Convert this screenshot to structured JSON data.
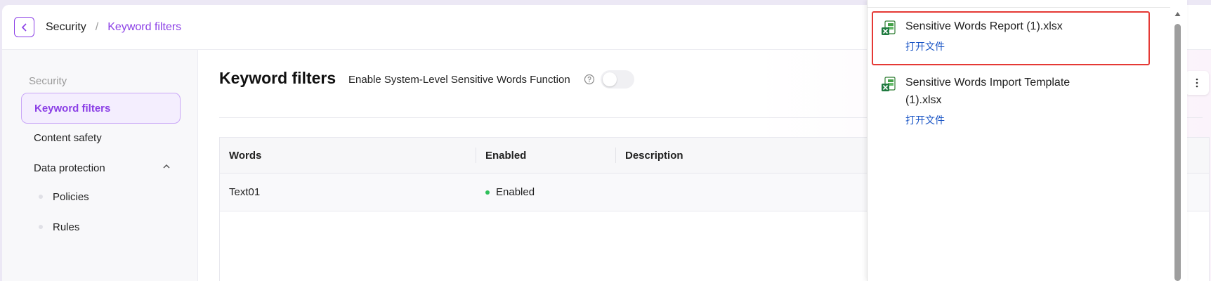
{
  "breadcrumb": {
    "parent": "Security",
    "separator": "/",
    "current": "Keyword filters"
  },
  "sidebar": {
    "section_label": "Security",
    "items": [
      {
        "label": "Keyword filters",
        "active": true
      },
      {
        "label": "Content safety"
      },
      {
        "label": "Data protection",
        "expanded": true
      }
    ],
    "sub_items": [
      {
        "label": "Policies"
      },
      {
        "label": "Rules"
      }
    ]
  },
  "main": {
    "title": "Keyword filters",
    "enable_label": "Enable System-Level Sensitive Words Function",
    "enable_toggle_on": false
  },
  "table": {
    "columns": [
      "Words",
      "Enabled",
      "Description"
    ],
    "rows": [
      {
        "words": "Text01",
        "enabled": "Enabled",
        "description": ""
      }
    ]
  },
  "downloads": {
    "items": [
      {
        "name": "Sensitive Words Report (1).xlsx",
        "action": "打开文件",
        "highlighted": true
      },
      {
        "name": "Sensitive Words Import Template (1).xlsx",
        "action": "打开文件"
      }
    ]
  },
  "colors": {
    "accent": "#8b3fe6",
    "link": "#1a55c5",
    "status_enabled": "#2fc05a",
    "highlight": "#e53935",
    "excel_green": "#1f7a3f"
  },
  "icons": [
    "back-arrow-icon",
    "help-circle-icon",
    "chevron-up-icon",
    "more-vertical-icon",
    "excel-file-icon",
    "scroll-up-arrow-icon"
  ]
}
